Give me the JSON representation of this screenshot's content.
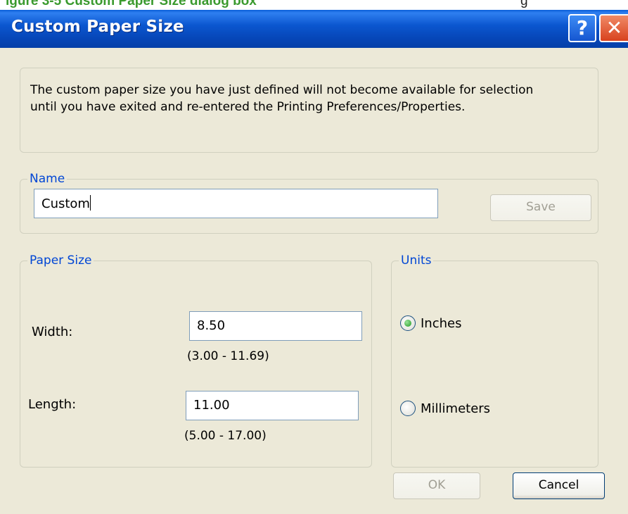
{
  "caption": {
    "left": "igure 3-5 Custom Paper Size dialog box",
    "right": "g"
  },
  "dialog": {
    "title": "Custom Paper Size",
    "help_label": "?",
    "close_label": "✕",
    "message": {
      "line1": "The custom paper size you have just defined will not become available for selection",
      "line2": "until you have exited and re-entered the Printing Preferences/Properties."
    },
    "name_group": {
      "legend": "Name",
      "value": "Custom",
      "save_label": "Save"
    },
    "paper_size_group": {
      "legend": "Paper Size",
      "width_label": "Width:",
      "width_value": "8.50",
      "width_range": "(3.00 - 11.69)",
      "length_label": "Length:",
      "length_value": "11.00",
      "length_range": "(5.00 - 17.00)"
    },
    "units_group": {
      "legend": "Units",
      "options": [
        {
          "label": "Inches",
          "selected": true
        },
        {
          "label": "Millimeters",
          "selected": false
        }
      ]
    },
    "ok_label": "OK",
    "cancel_label": "Cancel"
  },
  "colors": {
    "titlebar": "#0a57d0",
    "dialog_bg": "#ece9d8",
    "legend_text": "#0046d5",
    "caption_text": "#3a9a2e"
  }
}
